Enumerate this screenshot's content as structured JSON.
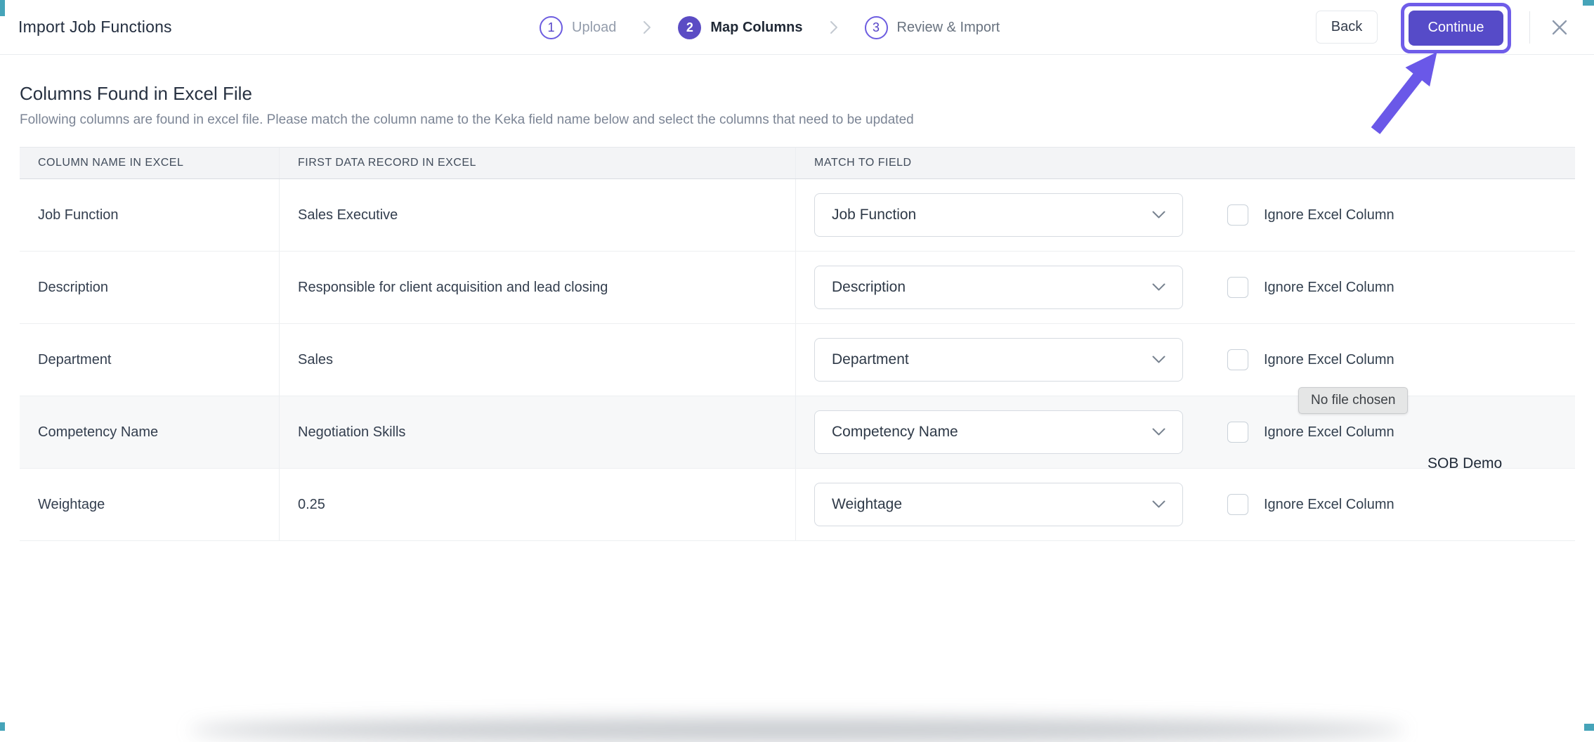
{
  "header": {
    "title": "Import Job Functions",
    "steps": [
      {
        "number": "1",
        "label": "Upload",
        "state": "inactive"
      },
      {
        "number": "2",
        "label": "Map Columns",
        "state": "active"
      },
      {
        "number": "3",
        "label": "Review & Import",
        "state": "upcoming"
      }
    ],
    "back_label": "Back",
    "continue_label": "Continue",
    "icons": {
      "close": "close-x",
      "step_separator": "chevron-right",
      "select_caret": "chevron-down"
    }
  },
  "content": {
    "heading": "Columns Found in Excel File",
    "subheading": "Following columns are found in excel file. Please match the column name to the Keka field name below and select the columns that need to be updated",
    "table": {
      "columns": [
        "COLUMN NAME IN EXCEL",
        "FIRST DATA RECORD IN EXCEL",
        "MATCH TO FIELD"
      ],
      "ignore_label": "Ignore Excel Column",
      "rows": [
        {
          "excel_column": "Job Function",
          "first_record": "Sales Executive",
          "matched_field": "Job Function",
          "ignored": false,
          "highlighted": false
        },
        {
          "excel_column": "Description",
          "first_record": "Responsible for client acquisition and lead closing",
          "matched_field": "Description",
          "ignored": false,
          "highlighted": false
        },
        {
          "excel_column": "Department",
          "first_record": "Sales",
          "matched_field": "Department",
          "ignored": false,
          "highlighted": false
        },
        {
          "excel_column": "Competency Name",
          "first_record": "Negotiation Skills",
          "matched_field": "Competency Name",
          "ignored": false,
          "highlighted": true
        },
        {
          "excel_column": "Weightage",
          "first_record": "0.25",
          "matched_field": "Weightage",
          "ignored": false,
          "highlighted": false
        }
      ]
    }
  },
  "overlays": {
    "tooltip": "No file chosen",
    "watermark": "SOB Demo"
  },
  "colors": {
    "accent_purple": "#564bc8",
    "annotation_purple": "#6f5de9",
    "header_bg": "#f3f4f6",
    "corner_marker_teal": "#46a4b9"
  }
}
